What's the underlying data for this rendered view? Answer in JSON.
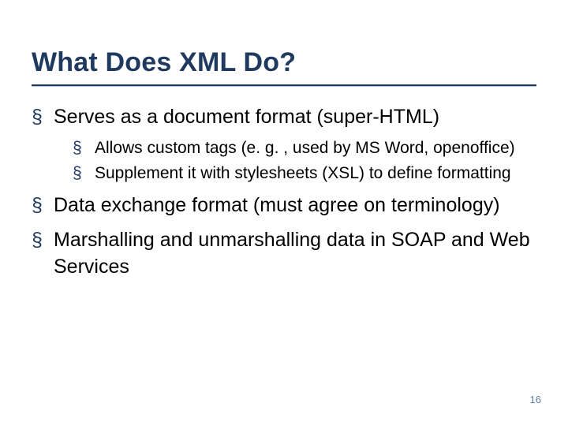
{
  "title": "What Does XML Do?",
  "bullets": {
    "b1": "Serves as a document format (super-HTML)",
    "b1a": "Allows custom tags (e. g. , used by MS Word, openoffice)",
    "b1b": "Supplement it with stylesheets (XSL) to define formatting",
    "b2": "Data exchange format (must agree on terminology)",
    "b3": "Marshalling and unmarshalling data in SOAP and Web Services"
  },
  "page_number": "16"
}
